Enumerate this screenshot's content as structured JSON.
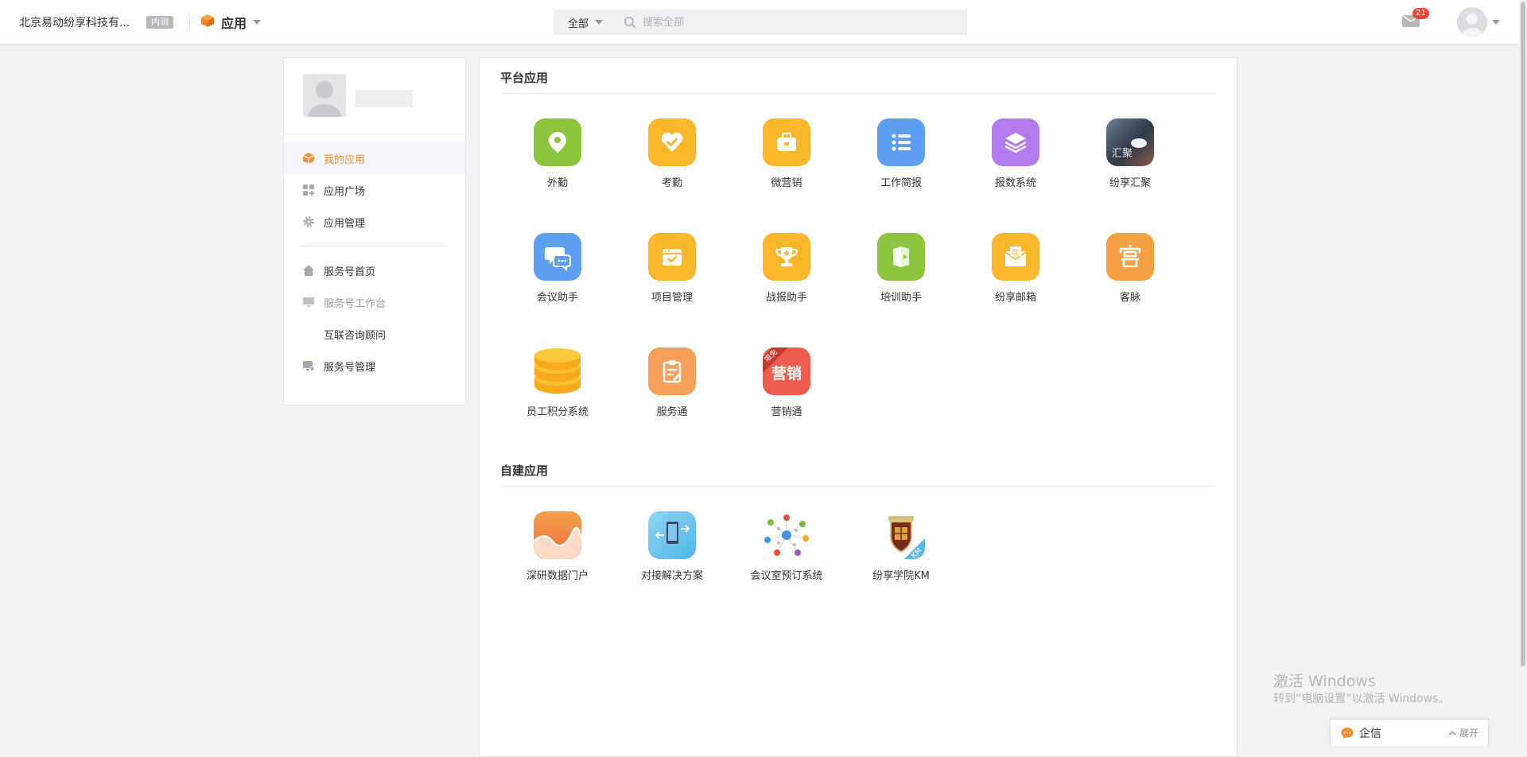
{
  "header": {
    "company": "北京易动纷享科技有...",
    "beta_badge": "内测",
    "app_label": "应用",
    "search_scope": "全部",
    "search_placeholder": "搜索全部",
    "mail_count": "21"
  },
  "sidebar": {
    "items": [
      {
        "label": "我的应用",
        "icon": "cube-icon",
        "active": true
      },
      {
        "label": "应用广场",
        "icon": "grid-plus-icon"
      },
      {
        "label": "应用管理",
        "icon": "gear-icon"
      },
      {
        "label": "服务号首页",
        "icon": "home-icon"
      },
      {
        "label": "服务号工作台",
        "icon": "monitor-icon",
        "disabled": true
      },
      {
        "label": "互联咨询顾问",
        "icon": ""
      },
      {
        "label": "服务号管理",
        "icon": "monitor-gear-icon"
      }
    ]
  },
  "platform": {
    "title": "平台应用",
    "apps": [
      {
        "name": "外勤",
        "icon": "location-pin-icon",
        "color": "#8cc63e"
      },
      {
        "name": "考勤",
        "icon": "heart-check-icon",
        "color": "#fbb72c"
      },
      {
        "name": "微营销",
        "icon": "briefcase-icon",
        "color": "#fbb72c"
      },
      {
        "name": "工作简报",
        "icon": "list-icon",
        "color": "#5e9ff1"
      },
      {
        "name": "报数系统",
        "icon": "layers-icon",
        "color": "#b47bef"
      },
      {
        "name": "纷享汇聚",
        "icon": "photo-icon",
        "color": "#3f4a5a",
        "text": "汇聚"
      },
      {
        "name": "会议助手",
        "icon": "chat-bubbles-icon",
        "color": "#5e9ff1"
      },
      {
        "name": "项目管理",
        "icon": "calendar-check-icon",
        "color": "#fbb72c"
      },
      {
        "name": "战报助手",
        "icon": "trophy-icon",
        "color": "#fbb72c"
      },
      {
        "name": "培训助手",
        "icon": "book-play-icon",
        "color": "#8cc63e"
      },
      {
        "name": "纷享邮箱",
        "icon": "envelope-at-icon",
        "color": "#fbb72c"
      },
      {
        "name": "客脉",
        "icon": "kemai-icon",
        "color": "#f4a043"
      },
      {
        "name": "员工积分系统",
        "icon": "coin-stack-icon",
        "color": "#fbbd2e"
      },
      {
        "name": "服务通",
        "icon": "clipboard-edit-icon",
        "color": "#f4a05a"
      },
      {
        "name": "营销通",
        "icon": "marketing-icon",
        "color": "#ee5c4d",
        "text": "营销",
        "ribbon": "限免"
      }
    ]
  },
  "custom": {
    "title": "自建应用",
    "apps": [
      {
        "name": "深研数据门户",
        "icon": "wave-chart-icon",
        "color": "#f38a3c"
      },
      {
        "name": "对接解决方案",
        "icon": "phone-transfer-icon",
        "color": "#69c4ee"
      },
      {
        "name": "会议室预订系统",
        "icon": "network-icon",
        "color": "#ffffff"
      },
      {
        "name": "纷享学院KM",
        "icon": "crest-icon",
        "color": "#ffffff",
        "text": "KM"
      }
    ]
  },
  "watermark": {
    "line1": "激活 Windows",
    "line2": "转到“电脑设置”以激活 Windows。"
  },
  "chat": {
    "label": "企信",
    "expand": "展开"
  }
}
